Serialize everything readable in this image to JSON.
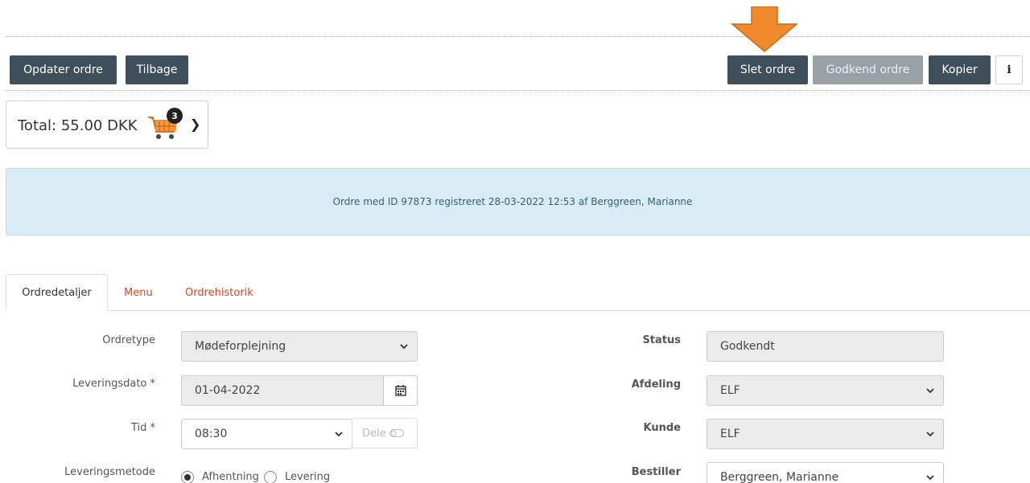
{
  "toolbar": {
    "update_order": "Opdater ordre",
    "back": "Tilbage",
    "delete_order": "Slet ordre",
    "approve_order": "Godkend ordre",
    "copy": "Kopier",
    "info": "i"
  },
  "cart": {
    "total_label": "Total: 55.00 DKK",
    "count": "3"
  },
  "banner": {
    "message": "Ordre med ID 97873 registreret 28-03-2022 12:53 af Berggreen, Marianne"
  },
  "tabs": [
    {
      "label": "Ordredetaljer"
    },
    {
      "label": "Menu"
    },
    {
      "label": "Ordrehistorik"
    }
  ],
  "form": {
    "order_type": {
      "label": "Ordretype",
      "value": "Mødeforplejning"
    },
    "delivery_date": {
      "label": "Leveringsdato *",
      "value": "01-04-2022"
    },
    "time": {
      "label": "Tid *",
      "value": "08:30",
      "share_label": "Dele"
    },
    "delivery_method": {
      "label": "Leveringsmetode",
      "options": [
        "Afhentning",
        "Levering"
      ],
      "selected": "Afhentning"
    },
    "status": {
      "label": "Status",
      "value": "Godkendt"
    },
    "department": {
      "label": "Afdeling",
      "value": "ELF"
    },
    "customer": {
      "label": "Kunde",
      "value": "ELF"
    },
    "orderer": {
      "label": "Bestiller",
      "value": "Berggreen, Marianne"
    }
  },
  "colors": {
    "button_dark": "#3e4e5b",
    "button_disabled": "#9aa1a6",
    "tab_link": "#e2411e",
    "info_bg": "#d9ecf5",
    "arrow": "#f08a2c"
  }
}
